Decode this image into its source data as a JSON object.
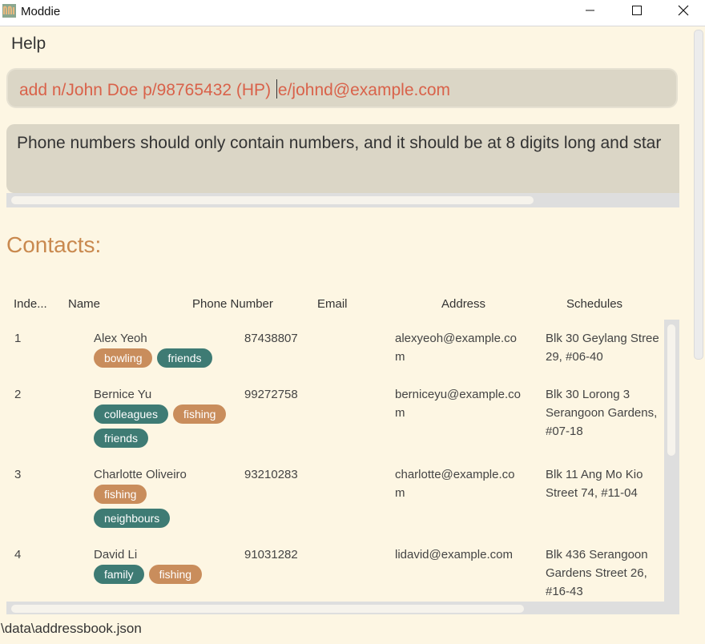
{
  "window": {
    "title": "Moddie"
  },
  "menu": {
    "help": "Help"
  },
  "command": {
    "before_caret": "add n/John Doe p/98765432 (HP) ",
    "after_caret": "e/johnd@example.com"
  },
  "result": {
    "text": "Phone numbers should only contain numbers, and it should be at 8 digits long and star"
  },
  "contacts": {
    "title": "Contacts:",
    "headers": [
      "Inde...",
      "Name",
      "Phone Number",
      "Email",
      "Address",
      "Schedules"
    ],
    "rows": [
      {
        "index": "1",
        "name": "Alex Yeoh",
        "phone": "87438807",
        "email_l1": "alexyeoh@example.co",
        "email_l2": "m",
        "addr_l1": "Blk 30 Geylang Stree",
        "addr_l2": "29, #06-40",
        "addr_l3": "",
        "tags": [
          {
            "label": "bowling",
            "color": "orange"
          },
          {
            "label": "friends",
            "color": "teal"
          }
        ]
      },
      {
        "index": "2",
        "name": "Bernice Yu",
        "phone": "99272758",
        "email_l1": "berniceyu@example.co",
        "email_l2": "m",
        "addr_l1": "Blk 30 Lorong 3",
        "addr_l2": "Serangoon Gardens,",
        "addr_l3": "#07-18",
        "tags": [
          {
            "label": "colleagues",
            "color": "teal"
          },
          {
            "label": "fishing",
            "color": "orange"
          },
          {
            "label": "friends",
            "color": "teal"
          }
        ]
      },
      {
        "index": "3",
        "name": "Charlotte Oliveiro",
        "phone": "93210283",
        "email_l1": "charlotte@example.co",
        "email_l2": "m",
        "addr_l1": "Blk 11 Ang Mo Kio",
        "addr_l2": "Street 74, #11-04",
        "addr_l3": "",
        "tags": [
          {
            "label": "fishing",
            "color": "orange"
          },
          {
            "label": "neighbours",
            "color": "teal"
          }
        ]
      },
      {
        "index": "4",
        "name": "David Li",
        "phone": "91031282",
        "email_l1": "lidavid@example.com",
        "email_l2": "",
        "addr_l1": "Blk 436 Serangoon",
        "addr_l2": "Gardens Street 26,",
        "addr_l3": "#16-43",
        "tags": [
          {
            "label": "family",
            "color": "teal"
          },
          {
            "label": "fishing",
            "color": "orange"
          }
        ]
      }
    ]
  },
  "status": {
    "path": "\\data\\addressbook.json"
  },
  "colors": {
    "tag_orange": "#c98d5c",
    "tag_teal": "#3e7b74",
    "accent": "#c9894f",
    "command_text": "#d9624a"
  },
  "icons": {
    "app": "moddie-logo-icon",
    "minimize": "minimize-icon",
    "maximize": "maximize-icon",
    "close": "close-icon"
  }
}
